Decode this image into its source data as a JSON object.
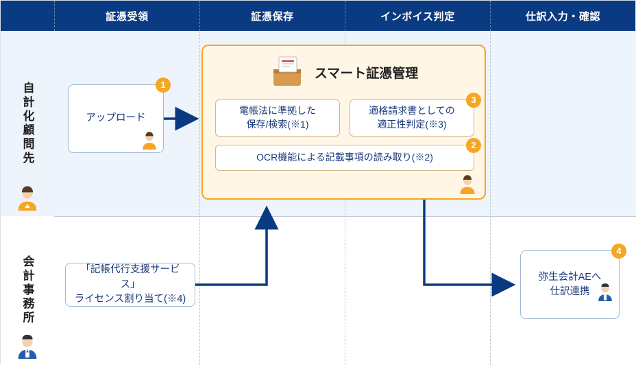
{
  "header": {
    "col1": "証憑受領",
    "col2": "証憑保存",
    "col3": "インボイス判定",
    "col4": "仕訳入力・確認"
  },
  "side": {
    "row1": "自計化顧問先",
    "row2": "会計事務所"
  },
  "boxes": {
    "upload": "アップロード",
    "license": "「記帳代行支援サービス」\nライセンス割り当て(※4)",
    "yayoi": "弥生会計AEへ\n仕訳連携"
  },
  "smart": {
    "title": "スマート証憑管理",
    "sub1": "電帳法に準拠した\n保存/検索(※1)",
    "sub2": "適格請求書としての\n適正性判定(※3)",
    "sub3": "OCR機能による記載事項の読み取り(※2)"
  },
  "badges": {
    "b1": "1",
    "b2": "2",
    "b3": "3",
    "b4": "4"
  }
}
